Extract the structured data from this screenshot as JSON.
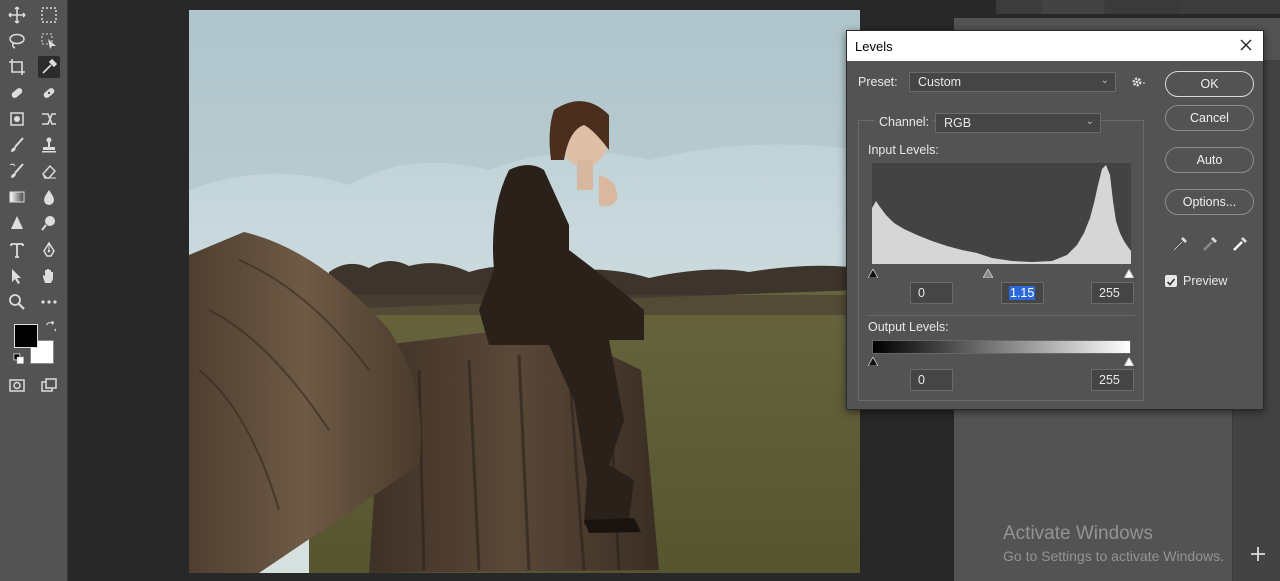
{
  "levels_dialog": {
    "title": "Levels",
    "preset_label": "Preset:",
    "preset_value": "Custom",
    "channel_label": "Channel:",
    "channel_value": "RGB",
    "input_levels_label": "Input Levels:",
    "input_black": "0",
    "input_gamma": "1.15",
    "input_white": "255",
    "output_levels_label": "Output Levels:",
    "output_black": "0",
    "output_white": "255",
    "buttons": {
      "ok": "OK",
      "cancel": "Cancel",
      "auto": "Auto",
      "options": "Options..."
    },
    "preview_label": "Preview",
    "preview_checked": true
  },
  "watermark": {
    "line1": "Activate Windows",
    "line2": "Go to Settings to activate Windows."
  },
  "colors": {
    "foreground": "#000000",
    "background": "#ffffff",
    "ui_panel": "#535353",
    "selection": "#2a6ad8"
  },
  "tools": [
    "move-icon",
    "marquee-icon",
    "lasso-icon",
    "object-select-icon",
    "crop-icon",
    "eyedropper-icon",
    "healing-icon",
    "bandage-icon",
    "patch-icon",
    "content-aware-move-icon",
    "brush-icon",
    "stamp-icon",
    "history-brush-icon",
    "eraser-icon",
    "gradient-icon",
    "blur-icon",
    "dodge-icon",
    "sharpen-icon",
    "type-icon",
    "pen-icon",
    "path-select-icon",
    "hand-icon",
    "zoom-icon",
    "more-icon",
    "quick-mask-icon",
    "screen-mode-icon"
  ]
}
